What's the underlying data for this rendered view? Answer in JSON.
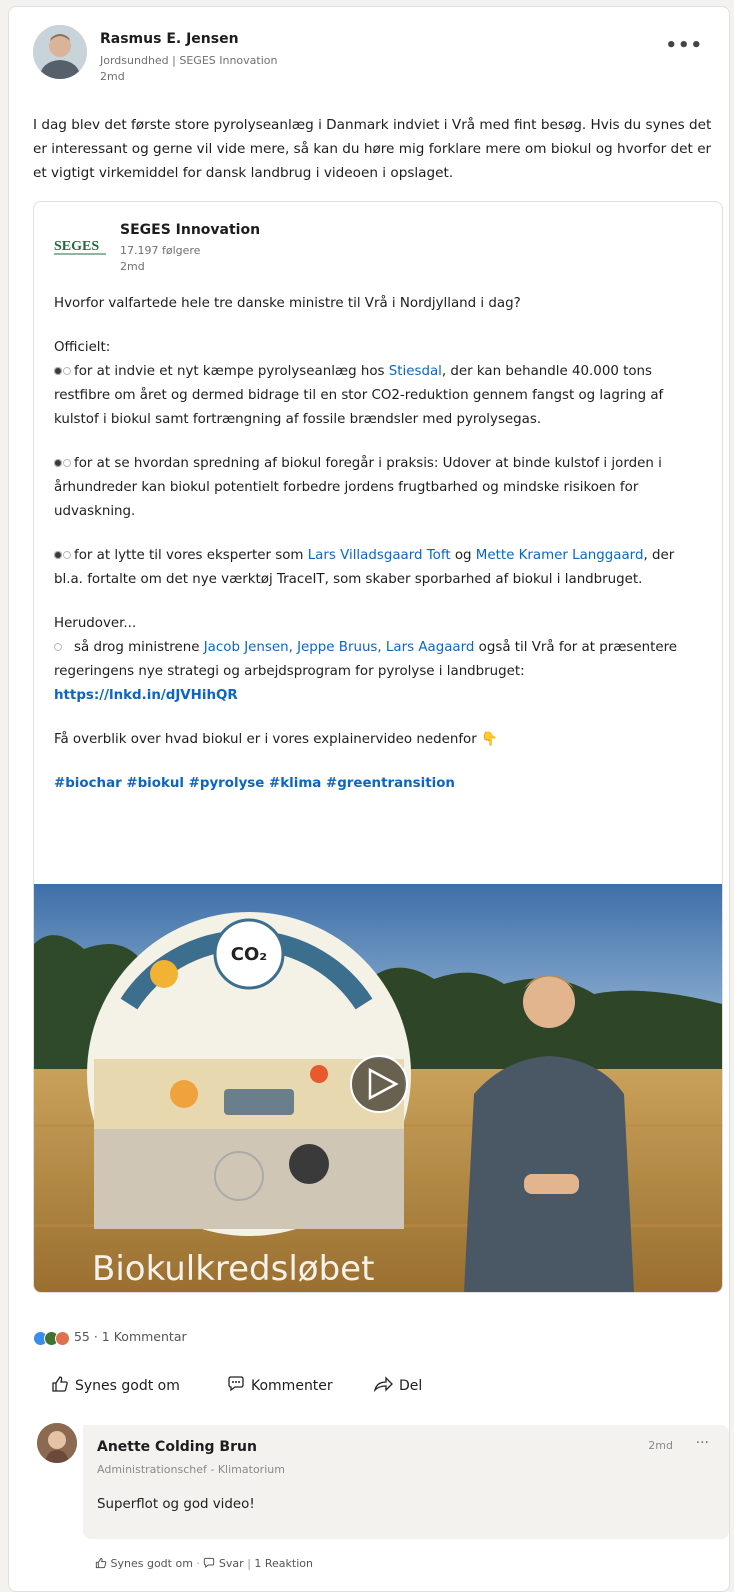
{
  "author": {
    "name": "Rasmus E. Jensen",
    "subtitle": "Jordsundhed | SEGES Innovation",
    "time": "2md"
  },
  "more_icon": "ellipsis-icon",
  "post_text": "I dag blev det første store pyrolyseanlæg i Danmark indviet i Vrå med fint besøg. Hvis du synes det er interessant og gerne vil vide mere, så kan du høre mig forklare mere om biokul og hvorfor det er et vigtigt virkemiddel for dansk landbrug i videoen i opslaget.",
  "repost": {
    "logo_text": "SEGES",
    "org": "SEGES Innovation",
    "followers": "17.197 følgere",
    "time": "2md",
    "intro": "Hvorfor valfartede hele tre danske ministre til Vrå i Nordjylland i dag?",
    "officielt": "Officielt:",
    "bullet1_a": "for at indvie et nyt kæmpe pyrolyseanlæg hos ",
    "bullet1_link": "Stiesdal",
    "bullet1_b": ", der kan behandle 40.000 tons restfibre om året og dermed bidrage til en stor CO2-reduktion gennem fangst og lagring af kulstof i biokul samt fortrængning af fossile brændsler med pyrolysegas.",
    "bullet2": "for at se hvordan spredning af biokul foregår i praksis: Udover at binde kulstof i jorden i århundreder kan biokul potentielt forbedre jordens frugtbarhed og mindske risikoen for udvaskning.",
    "bullet3_a": "for at lytte til vores eksperter som ",
    "bullet3_link1": "Lars Villadsgaard Toft",
    "bullet3_og": " og ",
    "bullet3_link2": "Mette Kramer Langgaard",
    "bullet3_b": ", der bl.a. fortalte om det nye værktøj TraceIT, som skaber sporbarhed af biokul i landbruget.",
    "herudover": "Herudover...",
    "bullet4_a": "så drog ministrene ",
    "bullet4_links": "Jacob Jensen, Jeppe Bruus, Lars Aagaard",
    "bullet4_b": " også til Vrå for at præsentere regeringens nye strategi og arbejdsprogram for pyrolyse i landbruget:",
    "url": "https://lnkd.in/dJVHihQR",
    "explainer": "Få overblik over hvad biokul er i vores explainervideo nedenfor",
    "explainer_emoji": "👇",
    "hashtags": "#biochar #biokul #pyrolyse #klima #greentransition",
    "video": {
      "caption": "Biokulkredsløbet",
      "co2_label": "CO₂",
      "play_icon": "play-icon"
    }
  },
  "reactions": {
    "count_text": "55 · 1 Kommentar",
    "colors": [
      "#378fe9",
      "#44712e",
      "#df704d"
    ]
  },
  "actions": {
    "like": "Synes godt om",
    "comment": "Kommenter",
    "share": "Del"
  },
  "comment": {
    "name": "Anette Colding Brun",
    "subtitle": "Administrationschef - Klimatorium",
    "time": "2md",
    "text": "Superflot og god video!",
    "like": "Synes godt om",
    "reply": "Svar",
    "reactions": "1 Reaktion"
  }
}
